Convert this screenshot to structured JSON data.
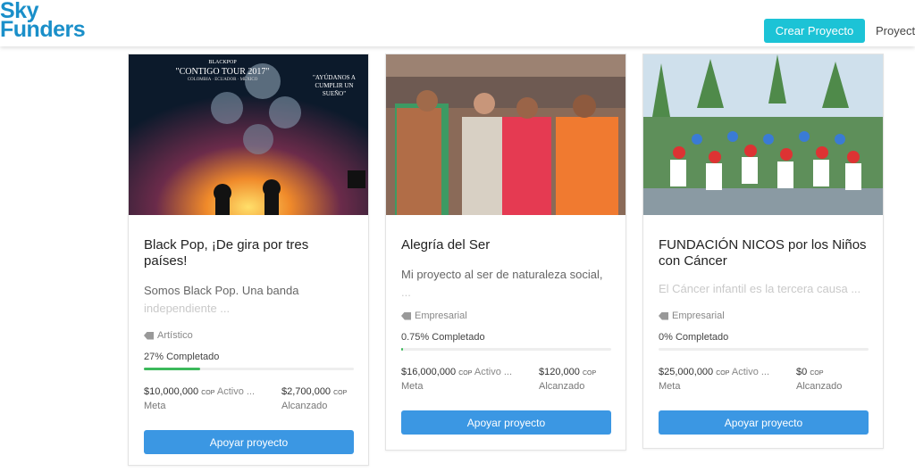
{
  "brand": {
    "line1": "Sky",
    "line2": "Funders"
  },
  "nav": {
    "create_label": "Crear Proyecto",
    "projects_label": "Proyecto"
  },
  "colors": {
    "accent": "#1cc3d6",
    "button": "#3b97e3",
    "progress": "#3cb95b"
  },
  "projects": [
    {
      "image": {
        "band": "BLACKPOP",
        "tour": "\"CONTIGO TOUR 2017\"",
        "countries": "COLOMBIA · ECUADOR · MÉXICO",
        "slogan": "\"AYÚDANOS A CUMPLIR UN SUEÑO\""
      },
      "title": "Black Pop, ¡De gira por tres países!",
      "desc_visible": "Somos Black Pop. Una banda",
      "desc_faded": "independiente ...",
      "category": "Artístico",
      "percent_label": "27% Completado",
      "percent": 27,
      "goal": "$10,000,000",
      "goal_currency": "COP",
      "status": "Activo ...",
      "goal_label": "Meta",
      "raised": "$2,700,000",
      "raised_currency": "COP",
      "raised_label": "Alcanzado",
      "button": "Apoyar proyecto"
    },
    {
      "title": "Alegría del Ser",
      "desc_visible": "Mi proyecto al ser de naturaleza social,",
      "desc_faded": "...",
      "category": "Empresarial",
      "percent_label": "0.75% Completado",
      "percent": 0.75,
      "goal": "$16,000,000",
      "goal_currency": "COP",
      "status": "Activo ...",
      "goal_label": "Meta",
      "raised": "$120,000",
      "raised_currency": "COP",
      "raised_label": "Alcanzado",
      "button": "Apoyar proyecto"
    },
    {
      "title": "FUNDACIÓN NICOS por los Niños con Cáncer",
      "desc_visible": "",
      "desc_faded": "El Cáncer infantil es la tercera causa ...",
      "category": "Empresarial",
      "percent_label": "0% Completado",
      "percent": 0,
      "goal": "$25,000,000",
      "goal_currency": "COP",
      "status": "Activo ...",
      "goal_label": "Meta",
      "raised": "$0",
      "raised_currency": "COP",
      "raised_label": "Alcanzado",
      "button": "Apoyar proyecto"
    }
  ]
}
